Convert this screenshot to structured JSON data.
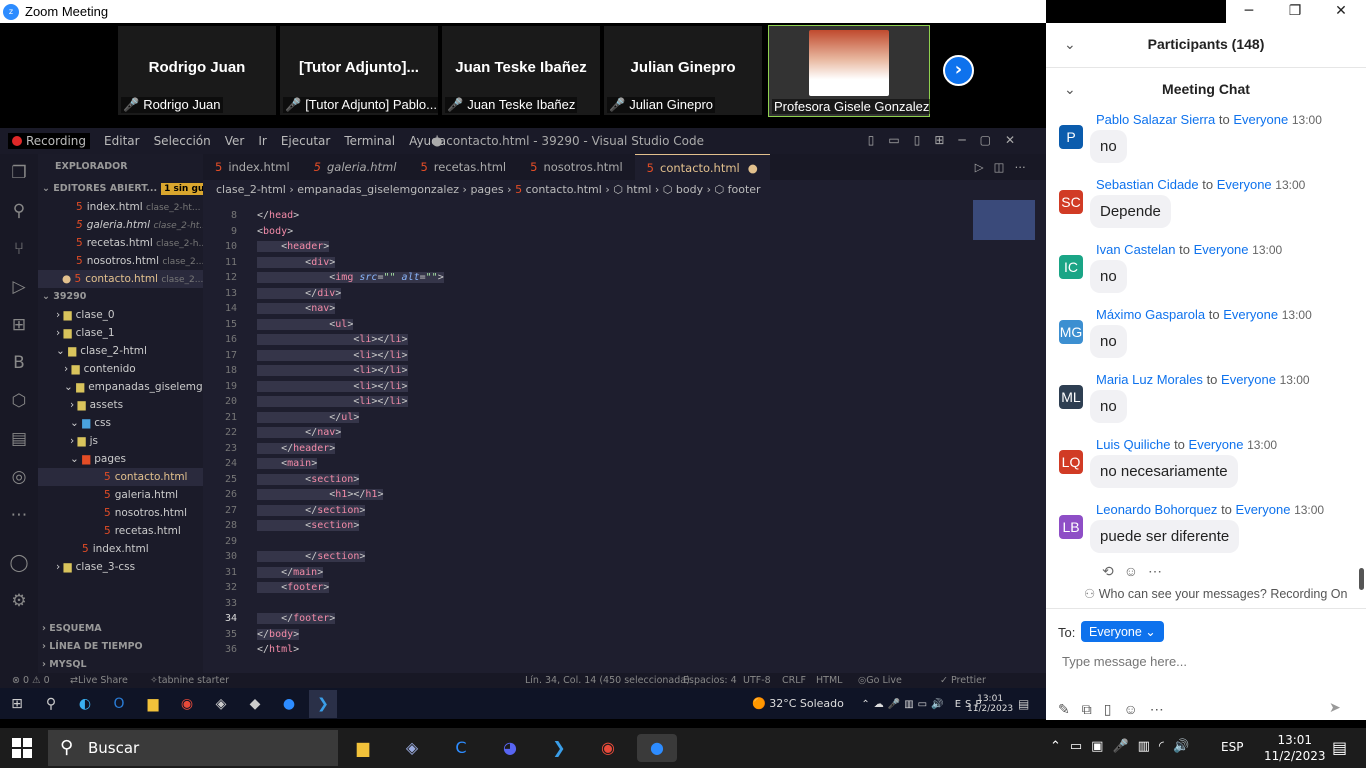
{
  "window": {
    "title": "Zoom Meeting"
  },
  "gallery": {
    "tiles": [
      {
        "big": "Rodrigo Juan",
        "small": "Rodrigo Juan"
      },
      {
        "big": "[Tutor  Adjunto]...",
        "small": "[Tutor Adjunto] Pablo..."
      },
      {
        "big": "Juan Teske Ibañez",
        "small": "Juan Teske Ibañez"
      },
      {
        "big": "Julian Ginepro",
        "small": "Julian Ginepro"
      },
      {
        "big": "",
        "small": "Profesora Gisele Gonzalez"
      }
    ],
    "next_icon": "chevron-right-icon"
  },
  "vscode": {
    "recording": "Recording",
    "menu": [
      "Editar",
      "Selección",
      "Ver",
      "Ir",
      "Ejecutar",
      "Terminal",
      "Ayuda"
    ],
    "title": "● contacto.html - 39290 - Visual Studio Code",
    "explorer": {
      "header": "EXPLORADOR",
      "open_editors": "EDITORES ABIERT...",
      "unsaved_badge": "1 sin guardar",
      "open_files": [
        {
          "name": "index.html",
          "path": "clase_2-ht..."
        },
        {
          "name": "galeria.html",
          "path": "clase_2-ht..."
        },
        {
          "name": "recetas.html",
          "path": "clase_2-h..."
        },
        {
          "name": "nosotros.html",
          "path": "clase_2..."
        },
        {
          "name": "contacto.html",
          "path": "clase_2..."
        }
      ],
      "workspace": "39290",
      "tree": [
        "clase_0",
        "clase_1",
        "clase_2-html",
        "contenido",
        "empanadas_giselemg...",
        "assets",
        "css",
        "js",
        "pages",
        "contacto.html",
        "galeria.html",
        "nosotros.html",
        "recetas.html",
        "index.html",
        "clase_3-css"
      ],
      "outline": "ESQUEMA",
      "timeline": "LÍNEA DE TIEMPO",
      "mysql": "MYSQL"
    },
    "tabs": [
      "index.html",
      "galeria.html",
      "recetas.html",
      "nosotros.html",
      "contacto.html"
    ],
    "breadcrumb": [
      "clase_2-html",
      "empanadas_giselemgonzalez",
      "pages",
      "contacto.html",
      "html",
      "body",
      "footer"
    ],
    "code": [
      {
        "n": "8",
        "t": "</head>"
      },
      {
        "n": "9",
        "t": "<body>"
      },
      {
        "n": "10",
        "t": "    <header>"
      },
      {
        "n": "11",
        "t": "        <div>"
      },
      {
        "n": "12",
        "t": "            <img src=\"\" alt=\"\">"
      },
      {
        "n": "13",
        "t": "        </div>"
      },
      {
        "n": "14",
        "t": "        <nav>"
      },
      {
        "n": "15",
        "t": "            <ul>"
      },
      {
        "n": "16",
        "t": "                <li></li>"
      },
      {
        "n": "17",
        "t": "                <li></li>"
      },
      {
        "n": "18",
        "t": "                <li></li>"
      },
      {
        "n": "19",
        "t": "                <li></li>"
      },
      {
        "n": "20",
        "t": "                <li></li>"
      },
      {
        "n": "21",
        "t": "            </ul>"
      },
      {
        "n": "22",
        "t": "        </nav>"
      },
      {
        "n": "23",
        "t": "    </header>"
      },
      {
        "n": "24",
        "t": "    <main>"
      },
      {
        "n": "25",
        "t": "        <section>"
      },
      {
        "n": "26",
        "t": "            <h1></h1>"
      },
      {
        "n": "27",
        "t": "        </section>"
      },
      {
        "n": "28",
        "t": "        <section>"
      },
      {
        "n": "29",
        "t": ""
      },
      {
        "n": "30",
        "t": "        </section>"
      },
      {
        "n": "31",
        "t": "    </main>"
      },
      {
        "n": "32",
        "t": "    <footer>"
      },
      {
        "n": "33",
        "t": ""
      },
      {
        "n": "34",
        "t": "    </footer>"
      },
      {
        "n": "35",
        "t": "</body>"
      },
      {
        "n": "36",
        "t": "</html>"
      }
    ],
    "status": {
      "errors": "⊗ 0 ⚠ 0",
      "liveshare": "Live Share",
      "tabnine": "tabnine starter",
      "position": "Lín. 34, Col. 14 (450 seleccionada)",
      "spaces": "Espacios: 4",
      "encoding": "UTF-8",
      "eol": "CRLF",
      "lang": "HTML",
      "golive": "Go Live",
      "prettier": "✓ Prettier"
    }
  },
  "mini_taskbar": {
    "weather": "32°C  Soleado",
    "lang": "ESP",
    "time": "13:01",
    "date": "11/2/2023"
  },
  "panel": {
    "participants": "Participants (148)",
    "chat_title": "Meeting Chat",
    "messages": [
      {
        "initials": "P",
        "color": "#0b5cad",
        "name": "Pablo Salazar Sierra",
        "to": "to",
        "target": "Everyone",
        "time": "13:00",
        "text": "no"
      },
      {
        "initials": "SC",
        "color": "#d13b25",
        "name": "Sebastian Cidade",
        "to": "to",
        "target": "Everyone",
        "time": "13:00",
        "text": "Depende"
      },
      {
        "initials": "IC",
        "color": "#1aa586",
        "name": "Ivan Castelan",
        "to": "to",
        "target": "Everyone",
        "time": "13:00",
        "text": "no"
      },
      {
        "initials": "MG",
        "color": "#3c8fd1",
        "name": "Máximo Gasparola",
        "to": "to",
        "target": "Everyone",
        "time": "13:00",
        "text": "no"
      },
      {
        "initials": "ML",
        "color": "#2e3f52",
        "name": "Maria Luz Morales",
        "to": "to",
        "target": "Everyone",
        "time": "13:00",
        "text": "no"
      },
      {
        "initials": "LQ",
        "color": "#d13b25",
        "name": "Luis Quiliche",
        "to": "to",
        "target": "Everyone",
        "time": "13:00",
        "text": "no necesariamente"
      },
      {
        "initials": "LB",
        "color": "#8e4ec6",
        "name": "Leonardo Bohorquez",
        "to": "to",
        "target": "Everyone",
        "time": "13:00",
        "text": "puede ser diferente"
      }
    ],
    "privacy": "Who can see your messages? Recording On",
    "to_label": "To:",
    "to_value": "Everyone",
    "input_placeholder": "Type message here..."
  },
  "taskbar": {
    "search": "Buscar",
    "lang": "ESP",
    "time": "13:01",
    "date": "11/2/2023"
  }
}
